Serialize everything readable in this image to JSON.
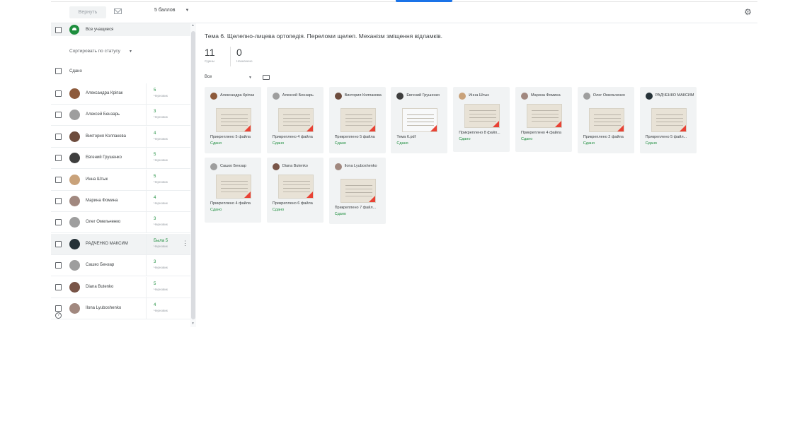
{
  "toolbar": {
    "return_label": "Вернуть",
    "points_label": "5 баллов",
    "mail_icon": "mail-icon",
    "settings_icon": "gear-icon"
  },
  "sidebar": {
    "all_students_label": "Все учащиеся",
    "sort_label": "Сортировать по статусу",
    "handed_in_label": "Сдано",
    "students": [
      {
        "name": "Александра Кріпак",
        "grade": "5",
        "grade_sub": "Черновик",
        "avatar_color": "#8d5a3b"
      },
      {
        "name": "Алексей Бензарь",
        "grade": "3",
        "grade_sub": "Черновик",
        "avatar_color": "#9e9e9e"
      },
      {
        "name": "Виктория Колпакова",
        "grade": "4",
        "grade_sub": "Черновик",
        "avatar_color": "#6d4c3d"
      },
      {
        "name": "Евгений Грушенко",
        "grade": "5",
        "grade_sub": "Черновик",
        "avatar_color": "#3e3e3e"
      },
      {
        "name": "Инна Штык",
        "grade": "5",
        "grade_sub": "Черновик",
        "avatar_color": "#c9a27a"
      },
      {
        "name": "Марина Фомина",
        "grade": "4",
        "grade_sub": "Черновик",
        "avatar_color": "#a1887f"
      },
      {
        "name": "Олег Омельченко",
        "grade": "3",
        "grade_sub": "Черновик",
        "avatar_color": "#9e9e9e"
      },
      {
        "name": "РАДЧЕНКО МАКСИМ",
        "grade": "Была 5",
        "grade_sub": "Черновик",
        "avatar_color": "#263238"
      },
      {
        "name": "Сашко Бензар",
        "grade": "3",
        "grade_sub": "Черновик",
        "avatar_color": "#9e9e9e"
      },
      {
        "name": "Diana Butenko",
        "grade": "5",
        "grade_sub": "Черновик",
        "avatar_color": "#795548"
      },
      {
        "name": "Ilona Lyuboshenko",
        "grade": "4",
        "grade_sub": "Черновик",
        "avatar_color": "#a1887f"
      }
    ]
  },
  "main": {
    "title": "Тема 6. Щелепно-лицева ортопедія. Переломи щелеп. Механізм зміщення відламків.",
    "handed_in_count": "11",
    "handed_in_label": "Сданы",
    "assigned_count": "0",
    "assigned_label": "Назначено",
    "filter_value": "Все",
    "cards": [
      {
        "name": "Александра Кріпак",
        "attachments": "Прикреплено 5 файла",
        "status": "Сдано",
        "avatar_color": "#8d5a3b"
      },
      {
        "name": "Алексей Бензарь",
        "attachments": "Прикреплено 4 файла",
        "status": "Сдано",
        "avatar_color": "#9e9e9e"
      },
      {
        "name": "Виктория Колпакова",
        "attachments": "Прикреплено 5 файла",
        "status": "Сдано",
        "avatar_color": "#6d4c3d"
      },
      {
        "name": "Евгений Грушенко",
        "attachments": "Тема 6.pdf",
        "status": "Сдано",
        "avatar_color": "#3e3e3e"
      },
      {
        "name": "Инна Штык",
        "attachments": "Прикреплено 8 файл...",
        "status": "Сдано",
        "avatar_color": "#c9a27a"
      },
      {
        "name": "Марина Фомина",
        "attachments": "Прикреплено 4 файла",
        "status": "Сдано",
        "avatar_color": "#a1887f"
      },
      {
        "name": "Олег Омельченко",
        "attachments": "Прикреплено 2 файла",
        "status": "Сдано",
        "avatar_color": "#9e9e9e"
      },
      {
        "name": "РАДЧЕНКО МАКСИМ",
        "attachments": "Прикреплено 5 файл...",
        "status": "Сдано",
        "avatar_color": "#263238"
      },
      {
        "name": "Сашко Бензар",
        "attachments": "Прикреплено 4 файла",
        "status": "Сдано",
        "avatar_color": "#9e9e9e"
      },
      {
        "name": "Diana Butenko",
        "attachments": "Прикреплено 6 файла",
        "status": "Сдано",
        "avatar_color": "#795548"
      },
      {
        "name": "Ilona Lyuboshenko",
        "attachments": "Прикреплено 7 файл...",
        "status": "Сдано",
        "avatar_color": "#a1887f"
      }
    ]
  },
  "colors": {
    "accent": "#1a73e8",
    "handed_in_green": "#1e8e3e",
    "pdf_red": "#e94235"
  }
}
